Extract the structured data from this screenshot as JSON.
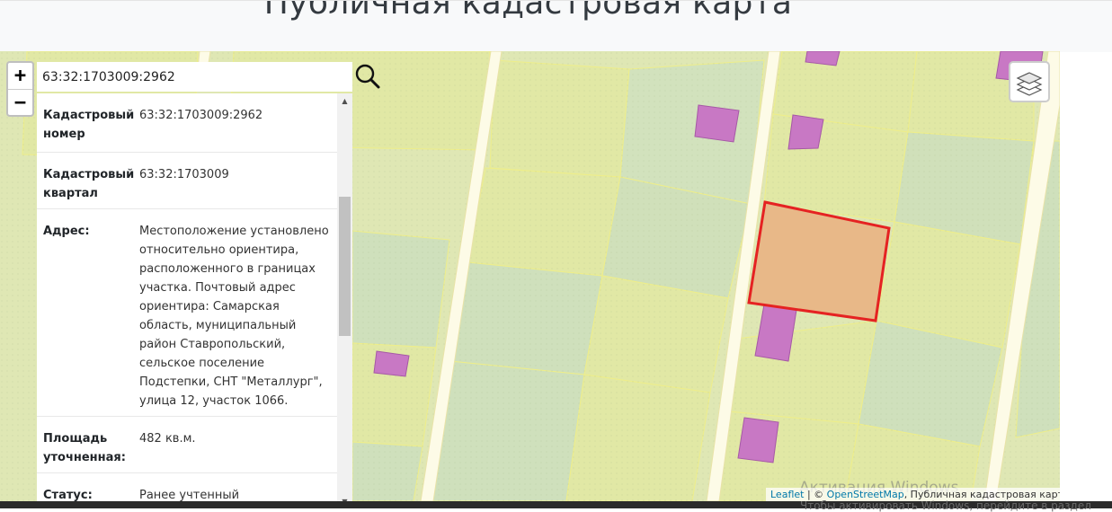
{
  "header": {
    "title": "Публичная кадастровая карта"
  },
  "map": {
    "colors": {
      "background": "#dfe7b4",
      "parcel": "#e1e8a5",
      "parcel_grey": "#cfe0bc",
      "road": "#fdfbe7",
      "building": "#c878c4",
      "selected_fill": "#e8b586",
      "selected_stroke": "#e52222"
    },
    "zoom_in_label": "+",
    "zoom_out_label": "−",
    "layers_icon": "layers-icon",
    "attribution": {
      "leaflet": "Leaflet",
      "separator": " | © ",
      "osm": "OpenStreetMap",
      "rest": ", Публичная кадастровая карта"
    },
    "watermark": "Активация Windows",
    "watermark_hint": "Чтобы активировать Windows, перейдите в раздел"
  },
  "search": {
    "value": "63:32:1703009:2962",
    "icon": "search-icon"
  },
  "info": {
    "rows": [
      {
        "label": "Кадастровый номер",
        "value": "63:32:1703009:2962"
      },
      {
        "label": "Кадастровый квартал",
        "value": "63:32:1703009"
      },
      {
        "label": "Адрес:",
        "value": "Местоположение установлено относительно ориентира, расположенного в границах участка. Почтовый адрес ориентира: Самарская область, муниципальный район Ставропольский, сельское поселение Подстепки, СНТ \"Металлург\", улица 12, участок 1066."
      },
      {
        "label": "Площадь уточненная:",
        "value": "482 кв.м."
      },
      {
        "label": "Статус:",
        "value": "Ранее учтенный"
      }
    ]
  }
}
